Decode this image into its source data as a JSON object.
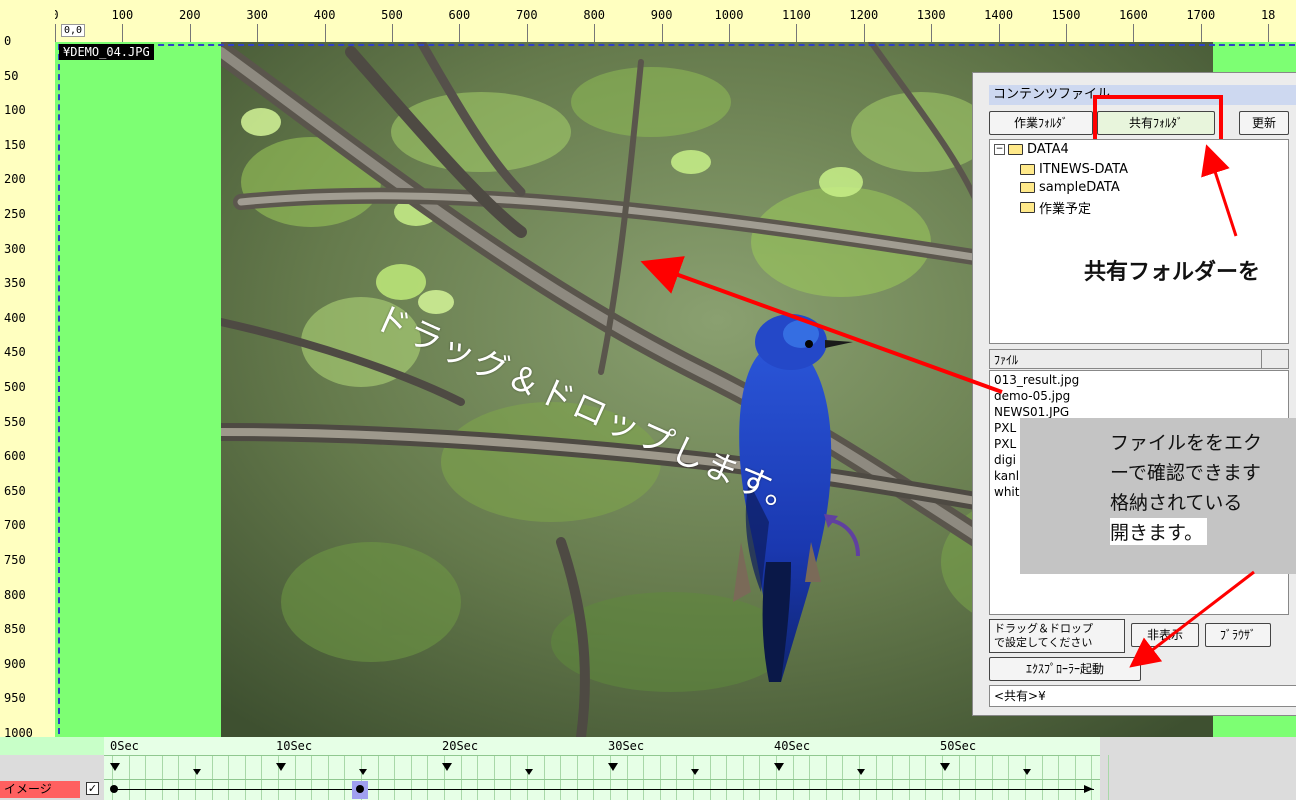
{
  "ruler": {
    "top_labels": [
      "0",
      "100",
      "200",
      "300",
      "400",
      "500",
      "600",
      "700",
      "800",
      "900",
      "1000",
      "1100",
      "1200",
      "1300",
      "1400",
      "1500",
      "1600",
      "1700",
      "18"
    ],
    "left_labels": [
      "0",
      "50",
      "100",
      "150",
      "200",
      "250",
      "300",
      "350",
      "400",
      "450",
      "500",
      "550",
      "600",
      "650",
      "700",
      "750",
      "800",
      "850",
      "900",
      "950",
      "1000"
    ],
    "origin": "0,0"
  },
  "canvas": {
    "filename": "¥DEMO_04.JPG",
    "photo_subject": "blue bird on branch"
  },
  "annotations": {
    "drag_drop": "ドラッグ＆ドロップします。",
    "shared_folder": "共有フォルダーを",
    "callout_lines": [
      "ファイルををエク",
      "ーで確認できます",
      "格納されている",
      "開きます。"
    ]
  },
  "panel": {
    "title": "コンテンツファイル",
    "btn_work_folder": "作業ﾌｫﾙﾀﾞ",
    "btn_shared_folder": "共有ﾌｫﾙﾀﾞ",
    "btn_refresh": "更新",
    "tree": {
      "root": "DATA4",
      "children": [
        "ITNEWS-DATA",
        "sampleDATA",
        "作業予定"
      ]
    },
    "file_header": "ﾌｧｲﾙ",
    "files": [
      "013_result.jpg",
      "demo-05.jpg",
      "NEWS01.JPG",
      "PXL",
      "PXL",
      "digi",
      "kanl",
      "whit"
    ],
    "drop_hint_line1": "ドラッグ＆ドロップ",
    "drop_hint_line2": "で設定してください",
    "btn_hide": "非表示",
    "btn_browser": "ﾌﾞﾗｳｻﾞ",
    "btn_explorer": "ｴｸｽﾌﾟﾛｰﾗｰ起動",
    "path": "<共有>¥"
  },
  "timeline": {
    "seconds": [
      "0Sec",
      "10Sec",
      "20Sec",
      "30Sec",
      "40Sec",
      "50Sec"
    ],
    "track_label": "イメージ",
    "track_checked": "✓"
  },
  "colors": {
    "canvas_green": "#7dff73",
    "ruler_yellow": "#ffffc0",
    "highlight_red": "#ff0000",
    "timeline_green": "#e6ffe6",
    "track_red": "#ff6060"
  }
}
